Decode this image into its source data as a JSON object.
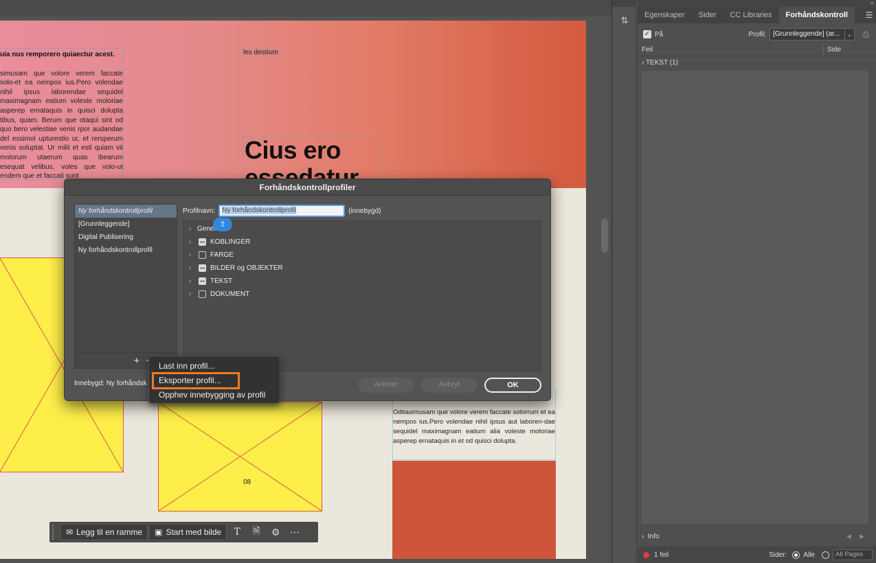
{
  "document": {
    "left_heading": "uia nus remporero quiaectur acest.",
    "left_body": "simusam que volore verem faccate solo-et ea nempos ius.Pero volendae nihil ipsus laborendae sequidel maximagnam eatium voleste moloriae asperep ernataquis in quisci dolupta tibus, quam. Berum que otaqui sint od quo bero velestiae venis rpor audandae del essimol upturestio ur, et rersperum venis soluptat. Ur milit et esti quiam vit molorum utaerum quas ibearum esequat velibus, voles que volo-ut endem que et faccati sunt",
    "top_label": "les destium",
    "headline": "Cius ero",
    "headline_cut": "essedatur",
    "right_body": "Oditasimusam que volore verem faccate solorrum et ea nempos ius.Pero volendae nihil ipsus aut laboren-dae sequidel maximagnam eatium alia voleste moloriae asperep ernataquis in et od quisci dolupta.",
    "page_number": "08"
  },
  "context_toolbar": {
    "add_frame": "Legg til en ramme",
    "start_image": "Start med bilde"
  },
  "right_panel": {
    "tabs": [
      "Egenskaper",
      "Sider",
      "CC Libraries",
      "Forhåndskontroll"
    ],
    "on_label": "På",
    "profile_label": "Profil:",
    "profile_value": "[Grunnleggende] (ar...",
    "col_error": "Feil",
    "col_page": "Side",
    "tree_item": "TEKST (1)",
    "info": "Info",
    "error_count": "1 feil",
    "pages_label": "Sider:",
    "all_label": "Alle",
    "pages_value": "All Pages"
  },
  "dialog": {
    "title": "Forhåndskontrollprofiler",
    "profiles": [
      "Ny forhåndskontrollprofil",
      "[Grunnleggende]",
      "Digital Publisering",
      "Ny forhåndskontrollprofil"
    ],
    "profile_name_label": "Profilnavn:",
    "profile_name_value": "Ny forhåndskontrollprofil",
    "builtin_tag": "(innebygd)",
    "categories": [
      {
        "label": "Generelt",
        "check": "none"
      },
      {
        "label": "KOBLINGER",
        "check": "mixed"
      },
      {
        "label": "FARGE",
        "check": "empty"
      },
      {
        "label": "BILDER og OBJEKTER",
        "check": "mixed"
      },
      {
        "label": "TEKST",
        "check": "mixed"
      },
      {
        "label": "DOKUMENT",
        "check": "empty"
      }
    ],
    "add_symbol": "+",
    "remove_symbol": "−",
    "embedded_label": "Innebygd:  Ny forhåndsk",
    "archive": "Arkiver",
    "cancel": "Avbryt",
    "ok": "OK"
  },
  "popup_menu": {
    "items": [
      "Last inn profil...",
      "Eksporter profil...",
      "Opphev innebygging av profil"
    ],
    "highlighted": "Eksporter profil..."
  },
  "colors": {
    "highlight": "#f07a2a",
    "accent": "#2f86dc",
    "error": "#e03a3a"
  }
}
